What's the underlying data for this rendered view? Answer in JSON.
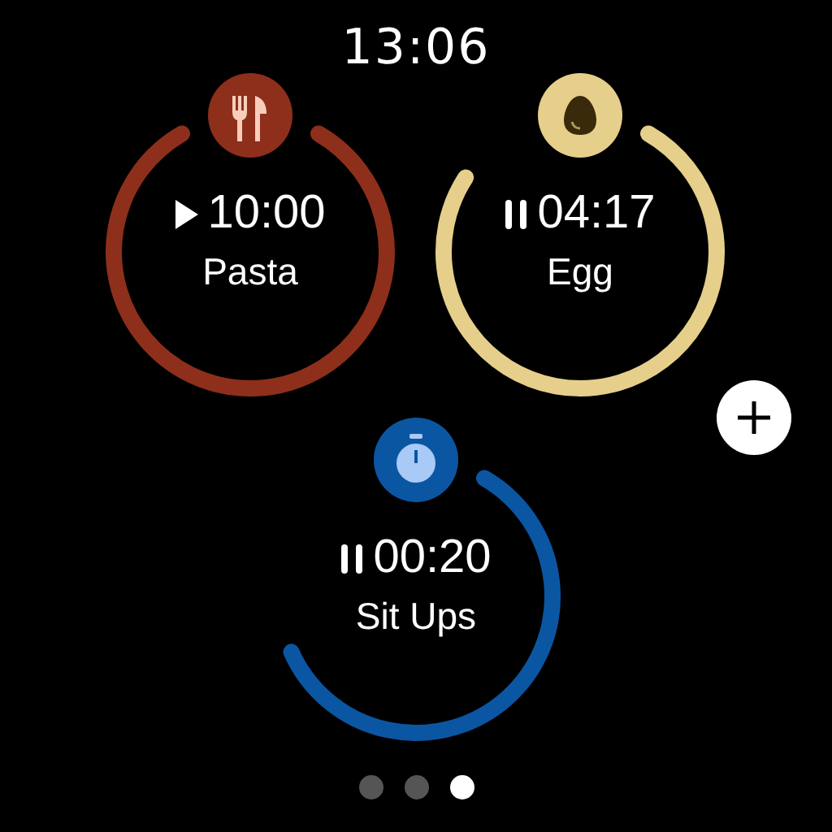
{
  "clock": "13:06",
  "timers": [
    {
      "kind": "food",
      "time": "10:00",
      "label": "Pasta",
      "running": false,
      "color": "#8e2f1b"
    },
    {
      "kind": "egg",
      "time": "04:17",
      "label": "Egg",
      "running": true,
      "color": "#e6cf8b"
    },
    {
      "kind": "stopwatch",
      "time": "00:20",
      "label": "Sit Ups",
      "running": true,
      "color": "#0b56a2"
    }
  ],
  "pages": [
    {
      "selected": false
    },
    {
      "selected": false
    },
    {
      "selected": true
    }
  ]
}
